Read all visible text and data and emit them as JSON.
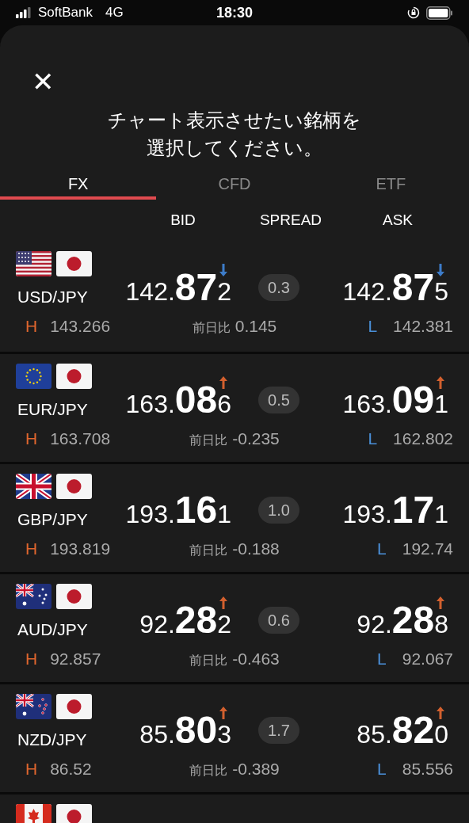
{
  "status_bar": {
    "carrier": "SoftBank",
    "network": "4G",
    "time": "18:30"
  },
  "dialog": {
    "close": "✕",
    "title_lines": [
      "チャート表示させたい銘柄を",
      "選択してください。"
    ]
  },
  "tabs": [
    {
      "label": "FX",
      "selected": true
    },
    {
      "label": "CFD",
      "selected": false
    },
    {
      "label": "ETF",
      "selected": false
    }
  ],
  "columns": [
    "BID",
    "SPREAD",
    "ASK"
  ],
  "rows": [
    {
      "flags": [
        {
          "kind": "us"
        },
        {
          "kind": "jp"
        }
      ],
      "pair": "USD/JPY",
      "bid": {
        "head": "142.",
        "big": "87",
        "tail": "2",
        "arrow": {
          "kind": "down"
        }
      },
      "spread": "0.3",
      "ask": {
        "head": "142.",
        "big": "87",
        "tail": "5",
        "arrow": {
          "kind": "down"
        }
      },
      "high_label": "H",
      "high": "143.266",
      "change_label": "前日比",
      "change": "0.145",
      "low_label": "L",
      "low": "142.381"
    },
    {
      "flags": [
        {
          "kind": "eu"
        },
        {
          "kind": "jp"
        }
      ],
      "pair": "EUR/JPY",
      "bid": {
        "head": "163.",
        "big": "08",
        "tail": "6",
        "arrow": {
          "kind": "up"
        }
      },
      "spread": "0.5",
      "ask": {
        "head": "163.",
        "big": "09",
        "tail": "1",
        "arrow": {
          "kind": "up"
        }
      },
      "high_label": "H",
      "high": "163.708",
      "change_label": "前日比",
      "change": "-0.235",
      "low_label": "L",
      "low": "162.802"
    },
    {
      "flags": [
        {
          "kind": "gb"
        },
        {
          "kind": "jp"
        }
      ],
      "pair": "GBP/JPY",
      "bid": {
        "head": "193.",
        "big": "16",
        "tail": "1"
      },
      "spread": "1.0",
      "ask": {
        "head": "193.",
        "big": "17",
        "tail": "1"
      },
      "high_label": "H",
      "high": "193.819",
      "change_label": "前日比",
      "change": "-0.188",
      "low_label": "L",
      "low": "192.74"
    },
    {
      "flags": [
        {
          "kind": "au"
        },
        {
          "kind": "jp"
        }
      ],
      "pair": "AUD/JPY",
      "bid": {
        "head": "92.",
        "big": "28",
        "tail": "2",
        "arrow": {
          "kind": "up"
        }
      },
      "spread": "0.6",
      "ask": {
        "head": "92.",
        "big": "28",
        "tail": "8",
        "arrow": {
          "kind": "up"
        }
      },
      "high_label": "H",
      "high": "92.857",
      "change_label": "前日比",
      "change": "-0.463",
      "low_label": "L",
      "low": "92.067"
    },
    {
      "flags": [
        {
          "kind": "nz"
        },
        {
          "kind": "jp"
        }
      ],
      "pair": "NZD/JPY",
      "bid": {
        "head": "85.",
        "big": "80",
        "tail": "3",
        "arrow": {
          "kind": "up"
        }
      },
      "spread": "1.7",
      "ask": {
        "head": "85.",
        "big": "82",
        "tail": "0",
        "arrow": {
          "kind": "up"
        }
      },
      "high_label": "H",
      "high": "86.52",
      "change_label": "前日比",
      "change": "-0.389",
      "low_label": "L",
      "low": "85.556"
    },
    {
      "flags": [
        {
          "kind": "ca"
        },
        {
          "kind": "jp"
        }
      ]
    }
  ]
}
